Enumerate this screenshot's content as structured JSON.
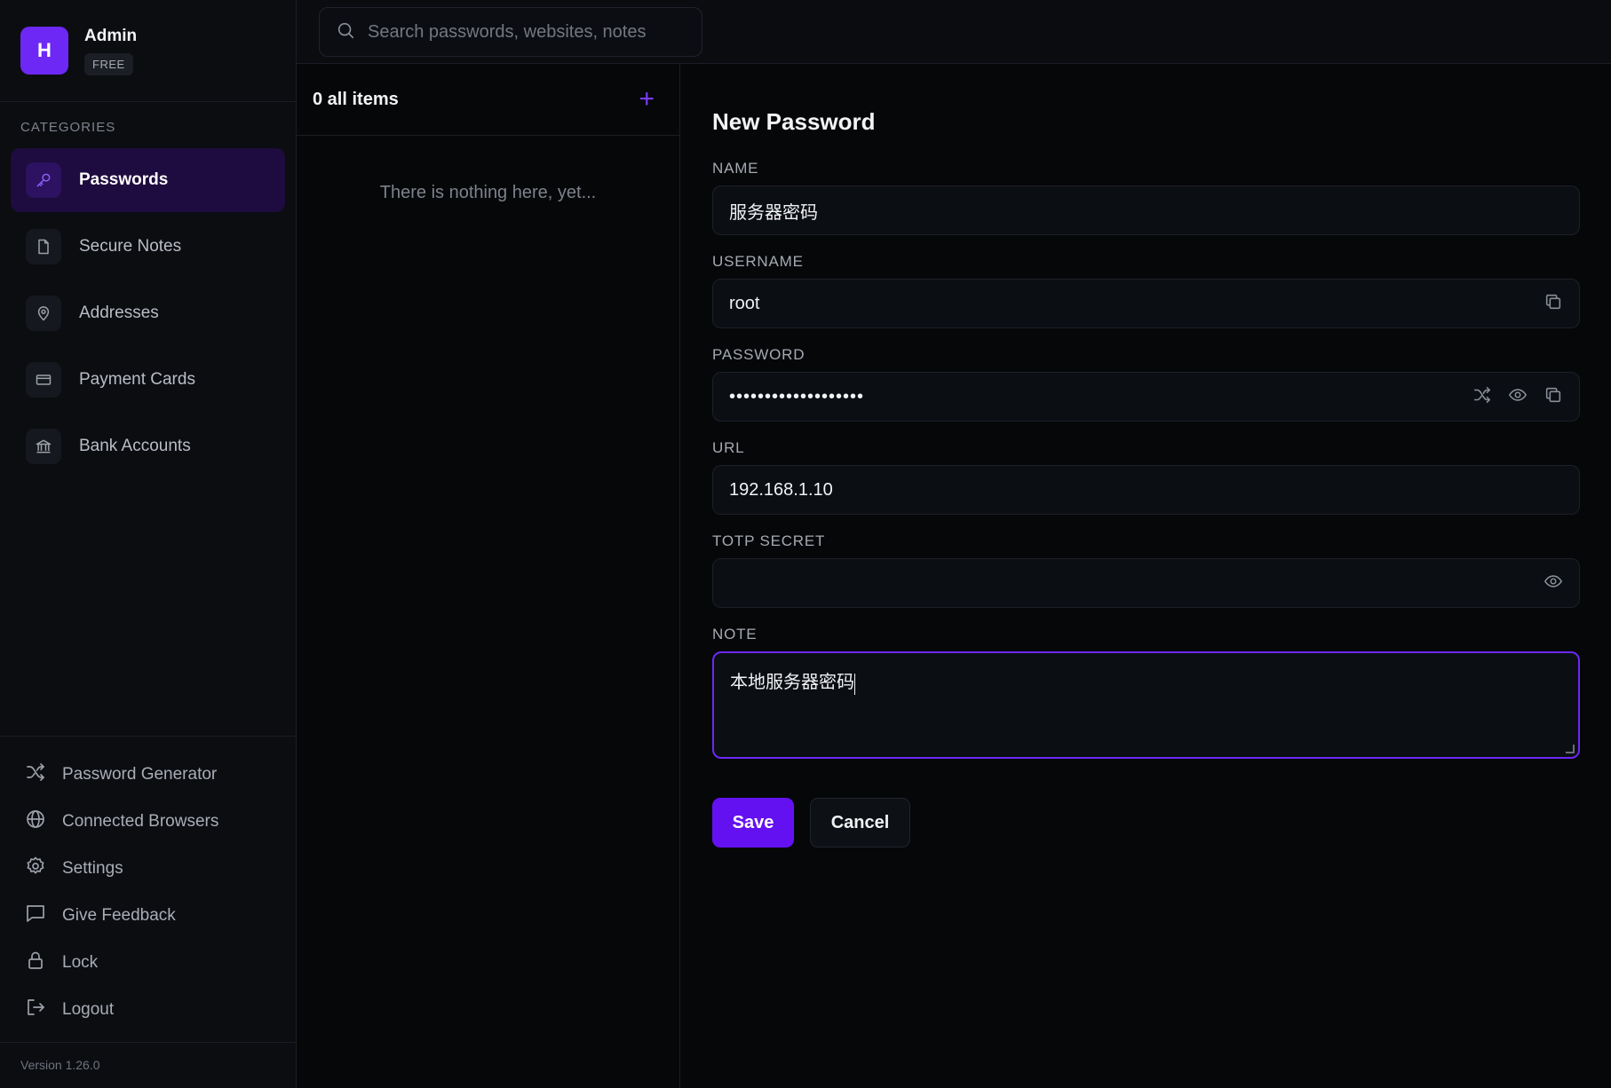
{
  "profile": {
    "avatar_letter": "H",
    "name": "Admin",
    "plan": "FREE"
  },
  "categories_label": "CATEGORIES",
  "categories": [
    {
      "label": "Passwords",
      "icon": "key-icon",
      "active": true
    },
    {
      "label": "Secure Notes",
      "icon": "note-icon",
      "active": false
    },
    {
      "label": "Addresses",
      "icon": "map-pin-icon",
      "active": false
    },
    {
      "label": "Payment Cards",
      "icon": "credit-card-icon",
      "active": false
    },
    {
      "label": "Bank Accounts",
      "icon": "bank-icon",
      "active": false
    }
  ],
  "bottom_nav": [
    {
      "label": "Password Generator",
      "icon": "shuffle-icon"
    },
    {
      "label": "Connected Browsers",
      "icon": "globe-icon"
    },
    {
      "label": "Settings",
      "icon": "gear-icon"
    },
    {
      "label": "Give Feedback",
      "icon": "chat-icon"
    },
    {
      "label": "Lock",
      "icon": "lock-icon"
    },
    {
      "label": "Logout",
      "icon": "logout-icon"
    }
  ],
  "version": "Version 1.26.0",
  "search": {
    "placeholder": "Search passwords, websites, notes",
    "value": ""
  },
  "list": {
    "count_label": "0 all items",
    "add_symbol": "+",
    "empty_text": "There is nothing here, yet..."
  },
  "form": {
    "title": "New Password",
    "name_label": "NAME",
    "name_value": "服务器密码",
    "username_label": "USERNAME",
    "username_value": "root",
    "password_label": "PASSWORD",
    "password_value": "•••••••••••••••••••",
    "url_label": "URL",
    "url_value": "192.168.1.10",
    "totp_label": "TOTP SECRET",
    "totp_value": "",
    "note_label": "NOTE",
    "note_value": "本地服务器密码",
    "save_label": "Save",
    "cancel_label": "Cancel"
  },
  "colors": {
    "accent": "#6d28f5",
    "background": "#060709",
    "sidebar": "#0b0d11"
  }
}
